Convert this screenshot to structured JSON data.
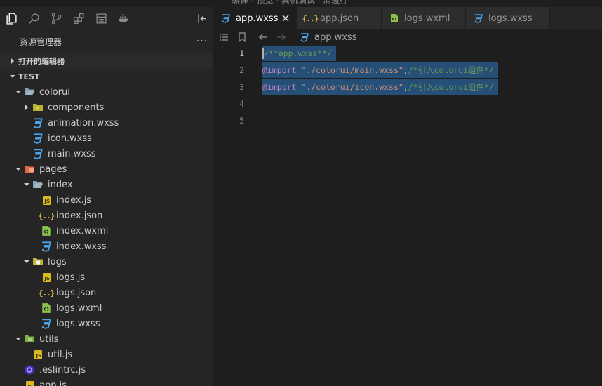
{
  "window": {
    "menu_strip": "编译 · 预览 · 真机调试 · 清缓存"
  },
  "activity_bar": {
    "icons": [
      "explorer-icon",
      "search-icon",
      "source-control-icon",
      "extensions-icon",
      "debug-icon",
      "docker-icon",
      "collapse-panel-icon"
    ]
  },
  "tabs": [
    {
      "label": "app.wxss",
      "icon": "css-icon",
      "active": true
    },
    {
      "label": "app.json",
      "icon": "json-icon",
      "active": false
    },
    {
      "label": "logs.wxml",
      "icon": "wxml-icon",
      "active": false
    },
    {
      "label": "logs.wxss",
      "icon": "css-icon",
      "active": false
    }
  ],
  "explorer": {
    "title": "资源管理器",
    "more": "···",
    "open_editors": "打开的编辑器",
    "root": "TEST",
    "tree": [
      {
        "label": "colorui",
        "depth": 1,
        "kind": "folder-open"
      },
      {
        "label": "components",
        "depth": 2,
        "kind": "folder-closed"
      },
      {
        "label": "animation.wxss",
        "depth": 2,
        "kind": "css"
      },
      {
        "label": "icon.wxss",
        "depth": 2,
        "kind": "css"
      },
      {
        "label": "main.wxss",
        "depth": 2,
        "kind": "css"
      },
      {
        "label": "pages",
        "depth": 1,
        "kind": "folder-pages"
      },
      {
        "label": "index",
        "depth": 2,
        "kind": "folder-open"
      },
      {
        "label": "index.js",
        "depth": 3,
        "kind": "js"
      },
      {
        "label": "index.json",
        "depth": 3,
        "kind": "json"
      },
      {
        "label": "index.wxml",
        "depth": 3,
        "kind": "wxml"
      },
      {
        "label": "index.wxss",
        "depth": 3,
        "kind": "css"
      },
      {
        "label": "logs",
        "depth": 2,
        "kind": "folder-logs"
      },
      {
        "label": "logs.js",
        "depth": 3,
        "kind": "js"
      },
      {
        "label": "logs.json",
        "depth": 3,
        "kind": "json"
      },
      {
        "label": "logs.wxml",
        "depth": 3,
        "kind": "wxml"
      },
      {
        "label": "logs.wxss",
        "depth": 3,
        "kind": "css"
      },
      {
        "label": "utils",
        "depth": 1,
        "kind": "folder-utils"
      },
      {
        "label": "util.js",
        "depth": 2,
        "kind": "js"
      },
      {
        "label": ".eslintrc.js",
        "depth": 1,
        "kind": "eslint"
      },
      {
        "label": "app.js",
        "depth": 1,
        "kind": "js"
      }
    ]
  },
  "breadcrumb": {
    "file": "app.wxss"
  },
  "editor": {
    "lines": [
      {
        "num": "1",
        "parts": [
          {
            "t": "/**app.wxss**/",
            "c": "comment"
          }
        ]
      },
      {
        "num": "2",
        "parts": [
          {
            "t": "@import ",
            "c": "at"
          },
          {
            "t": "\"./colorui/main.wxss\"",
            "c": "str"
          },
          {
            "t": ";",
            "c": "punct"
          },
          {
            "t": "/*引入colorui组件*/",
            "c": "comment"
          }
        ]
      },
      {
        "num": "3",
        "parts": [
          {
            "t": "@import ",
            "c": "at"
          },
          {
            "t": "\"./colorui/icon.wxss\"",
            "c": "str"
          },
          {
            "t": ";",
            "c": "punct"
          },
          {
            "t": "/*引入colorui组件*/",
            "c": "comment"
          }
        ]
      },
      {
        "num": "4",
        "parts": []
      },
      {
        "num": "5",
        "parts": []
      }
    ]
  },
  "colors": {
    "accent": "#0e639c",
    "selection": "#264f78",
    "css_icon": "#4aa3e8",
    "js_icon": "#d7ba1f",
    "wxml_icon": "#8bc34a"
  }
}
